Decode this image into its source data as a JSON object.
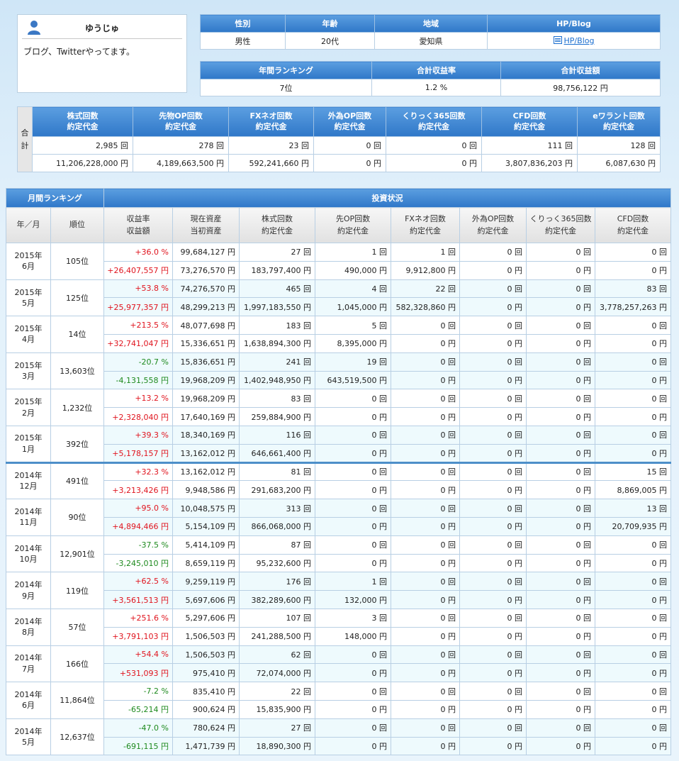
{
  "profile": {
    "name": "ゆうじゅ",
    "description": "ブログ、Twitterやってます。"
  },
  "info": {
    "headers": [
      "性別",
      "年齢",
      "地域",
      "HP/Blog"
    ],
    "gender": "男性",
    "age": "20代",
    "region": "愛知県",
    "blog_link": "HP/Blog"
  },
  "ranking": {
    "headers": [
      "年間ランキング",
      "合計収益率",
      "合計収益額"
    ],
    "annual_rank": "7位",
    "total_return_rate": "1.2 %",
    "total_return_amount": "98,756,122 円"
  },
  "totals": {
    "side_label": [
      "合",
      "計"
    ],
    "headers": [
      [
        "株式回数",
        "約定代金"
      ],
      [
        "先物OP回数",
        "約定代金"
      ],
      [
        "FXネオ回数",
        "約定代金"
      ],
      [
        "外為OP回数",
        "約定代金"
      ],
      [
        "くりっく365回数",
        "約定代金"
      ],
      [
        "CFD回数",
        "約定代金"
      ],
      [
        "eワラント回数",
        "約定代金"
      ]
    ],
    "counts": [
      "2,985 回",
      "278 回",
      "23 回",
      "0 回",
      "0 回",
      "111 回",
      "128 回"
    ],
    "amounts": [
      "11,206,228,000 円",
      "4,189,663,500 円",
      "592,241,660 円",
      "0 円",
      "0 円",
      "3,807,836,203 円",
      "6,087,630 円"
    ]
  },
  "monthly": {
    "title_left": "月間ランキング",
    "title_right": "投資状況",
    "col_headers": [
      [
        "年／月"
      ],
      [
        "順位"
      ],
      [
        "収益率",
        "収益額"
      ],
      [
        "現在資産",
        "当初資産"
      ],
      [
        "株式回数",
        "約定代金"
      ],
      [
        "先OP回数",
        "約定代金"
      ],
      [
        "FXネオ回数",
        "約定代金"
      ],
      [
        "外為OP回数",
        "約定代金"
      ],
      [
        "くりっく365回数",
        "約定代金"
      ],
      [
        "CFD回数",
        "約定代金"
      ]
    ],
    "rows": [
      {
        "year": "2015年",
        "month": "6月",
        "rank": "105位",
        "rate": "+36.0 %",
        "profit": "+26,407,557 円",
        "sign": "pos",
        "top": [
          "99,684,127 円",
          "27 回",
          "1 回",
          "1 回",
          "0 回",
          "0 回",
          "0 回"
        ],
        "bottom": [
          "73,276,570 円",
          "183,797,400 円",
          "490,000 円",
          "9,912,800 円",
          "0 円",
          "0 円",
          "0 円"
        ]
      },
      {
        "year": "2015年",
        "month": "5月",
        "rank": "125位",
        "rate": "+53.8 %",
        "profit": "+25,977,357 円",
        "sign": "pos",
        "top": [
          "74,276,570 円",
          "465 回",
          "4 回",
          "22 回",
          "0 回",
          "0 回",
          "83 回"
        ],
        "bottom": [
          "48,299,213 円",
          "1,997,183,550 円",
          "1,045,000 円",
          "582,328,860 円",
          "0 円",
          "0 円",
          "3,778,257,263 円"
        ]
      },
      {
        "year": "2015年",
        "month": "4月",
        "rank": "14位",
        "rate": "+213.5 %",
        "profit": "+32,741,047 円",
        "sign": "pos",
        "top": [
          "48,077,698 円",
          "183 回",
          "5 回",
          "0 回",
          "0 回",
          "0 回",
          "0 回"
        ],
        "bottom": [
          "15,336,651 円",
          "1,638,894,300 円",
          "8,395,000 円",
          "0 円",
          "0 円",
          "0 円",
          "0 円"
        ]
      },
      {
        "year": "2015年",
        "month": "3月",
        "rank": "13,603位",
        "rate": "-20.7 %",
        "profit": "-4,131,558 円",
        "sign": "neg",
        "top": [
          "15,836,651 円",
          "241 回",
          "19 回",
          "0 回",
          "0 回",
          "0 回",
          "0 回"
        ],
        "bottom": [
          "19,968,209 円",
          "1,402,948,950 円",
          "643,519,500 円",
          "0 円",
          "0 円",
          "0 円",
          "0 円"
        ]
      },
      {
        "year": "2015年",
        "month": "2月",
        "rank": "1,232位",
        "rate": "+13.2 %",
        "profit": "+2,328,040 円",
        "sign": "pos",
        "top": [
          "19,968,209 円",
          "83 回",
          "0 回",
          "0 回",
          "0 回",
          "0 回",
          "0 回"
        ],
        "bottom": [
          "17,640,169 円",
          "259,884,900 円",
          "0 円",
          "0 円",
          "0 円",
          "0 円",
          "0 円"
        ]
      },
      {
        "year": "2015年",
        "month": "1月",
        "rank": "392位",
        "rate": "+39.3 %",
        "profit": "+5,178,157 円",
        "sign": "pos",
        "top": [
          "18,340,169 円",
          "116 回",
          "0 回",
          "0 回",
          "0 回",
          "0 回",
          "0 回"
        ],
        "bottom": [
          "13,162,012 円",
          "646,661,400 円",
          "0 円",
          "0 円",
          "0 円",
          "0 円",
          "0 円"
        ]
      },
      {
        "year": "2014年",
        "month": "12月",
        "rank": "491位",
        "rate": "+32.3 %",
        "profit": "+3,213,426 円",
        "sign": "pos",
        "top": [
          "13,162,012 円",
          "81 回",
          "0 回",
          "0 回",
          "0 回",
          "0 回",
          "15 回"
        ],
        "bottom": [
          "9,948,586 円",
          "291,683,200 円",
          "0 円",
          "0 円",
          "0 円",
          "0 円",
          "8,869,005 円"
        ]
      },
      {
        "year": "2014年",
        "month": "11月",
        "rank": "90位",
        "rate": "+95.0 %",
        "profit": "+4,894,466 円",
        "sign": "pos",
        "top": [
          "10,048,575 円",
          "313 回",
          "0 回",
          "0 回",
          "0 回",
          "0 回",
          "13 回"
        ],
        "bottom": [
          "5,154,109 円",
          "866,068,000 円",
          "0 円",
          "0 円",
          "0 円",
          "0 円",
          "20,709,935 円"
        ]
      },
      {
        "year": "2014年",
        "month": "10月",
        "rank": "12,901位",
        "rate": "-37.5 %",
        "profit": "-3,245,010 円",
        "sign": "neg",
        "top": [
          "5,414,109 円",
          "87 回",
          "0 回",
          "0 回",
          "0 回",
          "0 回",
          "0 回"
        ],
        "bottom": [
          "8,659,119 円",
          "95,232,600 円",
          "0 円",
          "0 円",
          "0 円",
          "0 円",
          "0 円"
        ]
      },
      {
        "year": "2014年",
        "month": "9月",
        "rank": "119位",
        "rate": "+62.5 %",
        "profit": "+3,561,513 円",
        "sign": "pos",
        "top": [
          "9,259,119 円",
          "176 回",
          "1 回",
          "0 回",
          "0 回",
          "0 回",
          "0 回"
        ],
        "bottom": [
          "5,697,606 円",
          "382,289,600 円",
          "132,000 円",
          "0 円",
          "0 円",
          "0 円",
          "0 円"
        ]
      },
      {
        "year": "2014年",
        "month": "8月",
        "rank": "57位",
        "rate": "+251.6 %",
        "profit": "+3,791,103 円",
        "sign": "pos",
        "top": [
          "5,297,606 円",
          "107 回",
          "3 回",
          "0 回",
          "0 回",
          "0 回",
          "0 回"
        ],
        "bottom": [
          "1,506,503 円",
          "241,288,500 円",
          "148,000 円",
          "0 円",
          "0 円",
          "0 円",
          "0 円"
        ]
      },
      {
        "year": "2014年",
        "month": "7月",
        "rank": "166位",
        "rate": "+54.4 %",
        "profit": "+531,093 円",
        "sign": "pos",
        "top": [
          "1,506,503 円",
          "62 回",
          "0 回",
          "0 回",
          "0 回",
          "0 回",
          "0 回"
        ],
        "bottom": [
          "975,410 円",
          "72,074,000 円",
          "0 円",
          "0 円",
          "0 円",
          "0 円",
          "0 円"
        ]
      },
      {
        "year": "2014年",
        "month": "6月",
        "rank": "11,864位",
        "rate": "-7.2 %",
        "profit": "-65,214 円",
        "sign": "neg",
        "top": [
          "835,410 円",
          "22 回",
          "0 回",
          "0 回",
          "0 回",
          "0 回",
          "0 回"
        ],
        "bottom": [
          "900,624 円",
          "15,835,900 円",
          "0 円",
          "0 円",
          "0 円",
          "0 円",
          "0 円"
        ]
      },
      {
        "year": "2014年",
        "month": "5月",
        "rank": "12,637位",
        "rate": "-47.0 %",
        "profit": "-691,115 円",
        "sign": "neg",
        "top": [
          "780,624 円",
          "27 回",
          "0 回",
          "0 回",
          "0 回",
          "0 回",
          "0 回"
        ],
        "bottom": [
          "1,471,739 円",
          "18,890,300 円",
          "0 円",
          "0 円",
          "0 円",
          "0 円",
          "0 円"
        ]
      }
    ]
  }
}
